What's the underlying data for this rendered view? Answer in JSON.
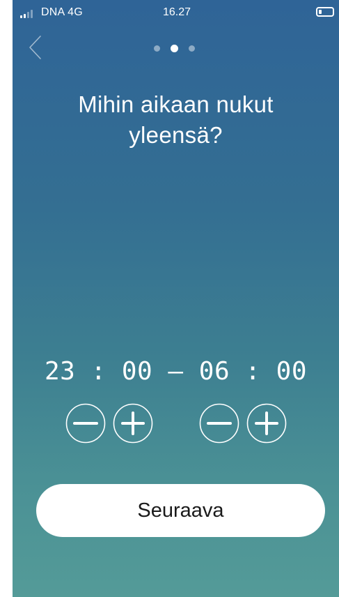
{
  "status_bar": {
    "carrier": "DNA 4G",
    "time": "16.27",
    "signal_bars_active": 2,
    "signal_bars_total": 4,
    "battery_level": 0.2
  },
  "pager": {
    "total": 3,
    "active_index": 1
  },
  "question": {
    "line1": "Mihin aikaan nukut",
    "line2": "yleensä?"
  },
  "sleep_time": {
    "start": "23 : 00",
    "separator": "—",
    "end": "06 : 00"
  },
  "actions": {
    "next_label": "Seuraava"
  },
  "colors": {
    "gradient_top": "#2f6497",
    "gradient_bottom": "#549b98",
    "button_bg": "#ffffff",
    "button_text": "#1a1a1a"
  },
  "icons": {
    "back": "chevron-left-icon",
    "decrement": "minus-circle-icon",
    "increment": "plus-circle-icon"
  }
}
